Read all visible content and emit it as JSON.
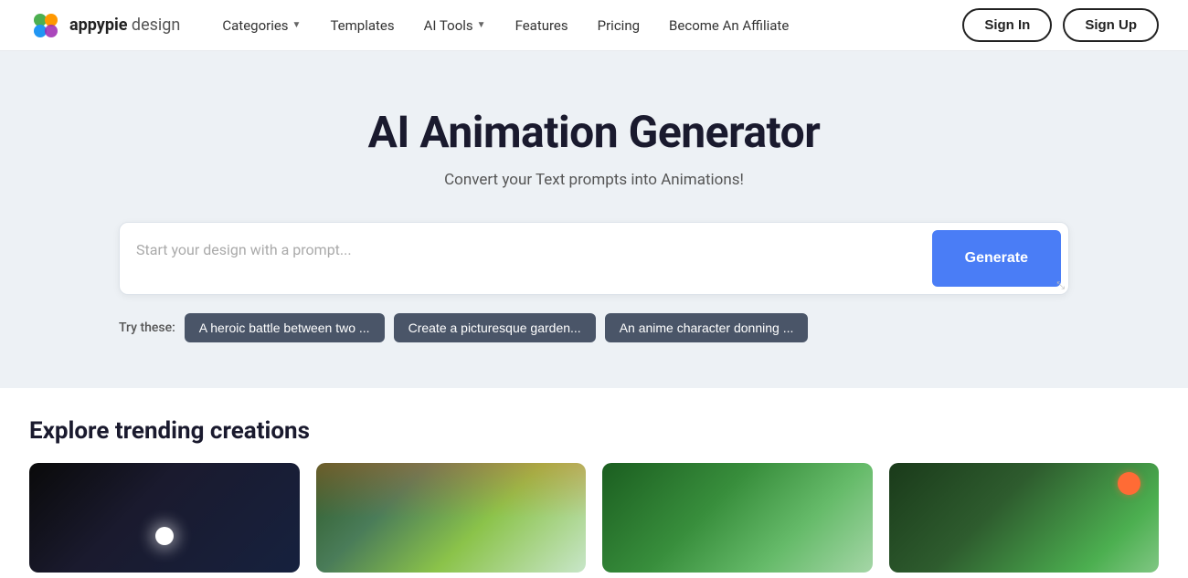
{
  "logo": {
    "name": "appypie design",
    "name_bold": "appypie",
    "name_light": " design"
  },
  "nav": {
    "items": [
      {
        "id": "categories",
        "label": "Categories",
        "hasDropdown": true
      },
      {
        "id": "templates",
        "label": "Templates",
        "hasDropdown": false
      },
      {
        "id": "ai-tools",
        "label": "AI Tools",
        "hasDropdown": true
      },
      {
        "id": "features",
        "label": "Features",
        "hasDropdown": false
      },
      {
        "id": "pricing",
        "label": "Pricing",
        "hasDropdown": false
      },
      {
        "id": "affiliate",
        "label": "Become An Affiliate",
        "hasDropdown": false
      }
    ],
    "sign_in": "Sign In",
    "sign_up": "Sign Up"
  },
  "hero": {
    "title": "AI Animation Generator",
    "subtitle": "Convert your Text prompts into Animations!",
    "prompt_placeholder": "Start your design with a prompt...",
    "generate_label": "Generate",
    "try_label": "Try these:",
    "chips": [
      {
        "id": "chip1",
        "label": "A heroic battle between two ..."
      },
      {
        "id": "chip2",
        "label": "Create a picturesque garden..."
      },
      {
        "id": "chip3",
        "label": "An anime character donning ..."
      }
    ]
  },
  "trending": {
    "title": "Explore trending creations"
  }
}
